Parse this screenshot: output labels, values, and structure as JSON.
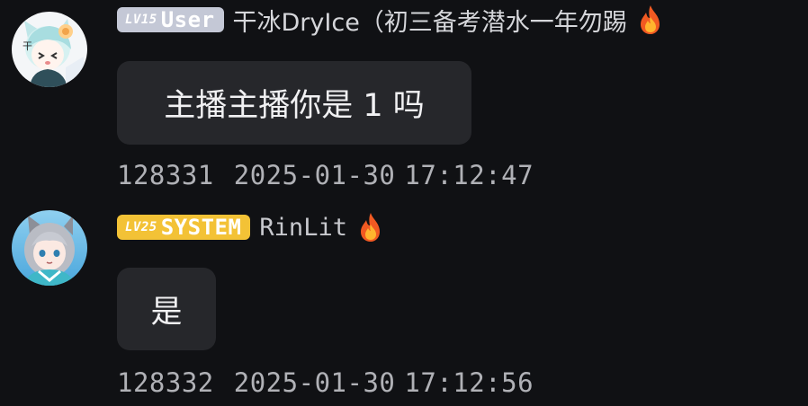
{
  "messages": [
    {
      "badge_level": "LV15",
      "badge_name": "User",
      "nickname": "干冰DryIce（初三备考潜水一年勿踢",
      "text": "主播主播你是 1 吗",
      "message_id": "128331",
      "date": "2025-01-30",
      "time": "17:12:47",
      "avatar_icon": "anime-avatar-icon",
      "badge_color": "#c4c8d6",
      "emoji_icon": "fire-icon"
    },
    {
      "badge_level": "LV25",
      "badge_name": "SYSTEM",
      "nickname": "RinLit",
      "text": "是",
      "message_id": "128332",
      "date": "2025-01-30",
      "time": "17:12:56",
      "avatar_icon": "anime-avatar-icon",
      "badge_color": "#f3c236",
      "emoji_icon": "fire-icon"
    }
  ]
}
